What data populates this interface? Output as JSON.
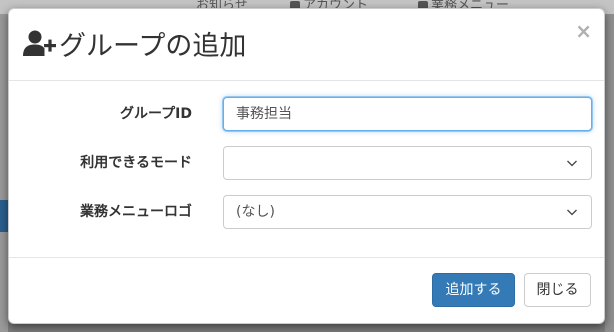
{
  "background": {
    "nav_items": [
      {
        "label": "お知らせ",
        "icon": "bell-icon"
      },
      {
        "label": "アカウント",
        "icon": "user-icon"
      },
      {
        "label": "業務メニュー",
        "icon": "cog-icon"
      }
    ]
  },
  "modal": {
    "title": "グループの追加",
    "title_icon": "user-plus-icon",
    "close_label": "×",
    "fields": {
      "group_id": {
        "label": "グループID",
        "value": "事務担当"
      },
      "available_mode": {
        "label": "利用できるモード",
        "value": ""
      },
      "menu_logo": {
        "label": "業務メニューロゴ",
        "value": "(なし)"
      }
    },
    "footer": {
      "add_label": "追加する",
      "close_label": "閉じる"
    }
  },
  "colors": {
    "primary": "#337ab7",
    "focus_border": "#66afe9",
    "overlay": "#7d7d7d"
  }
}
